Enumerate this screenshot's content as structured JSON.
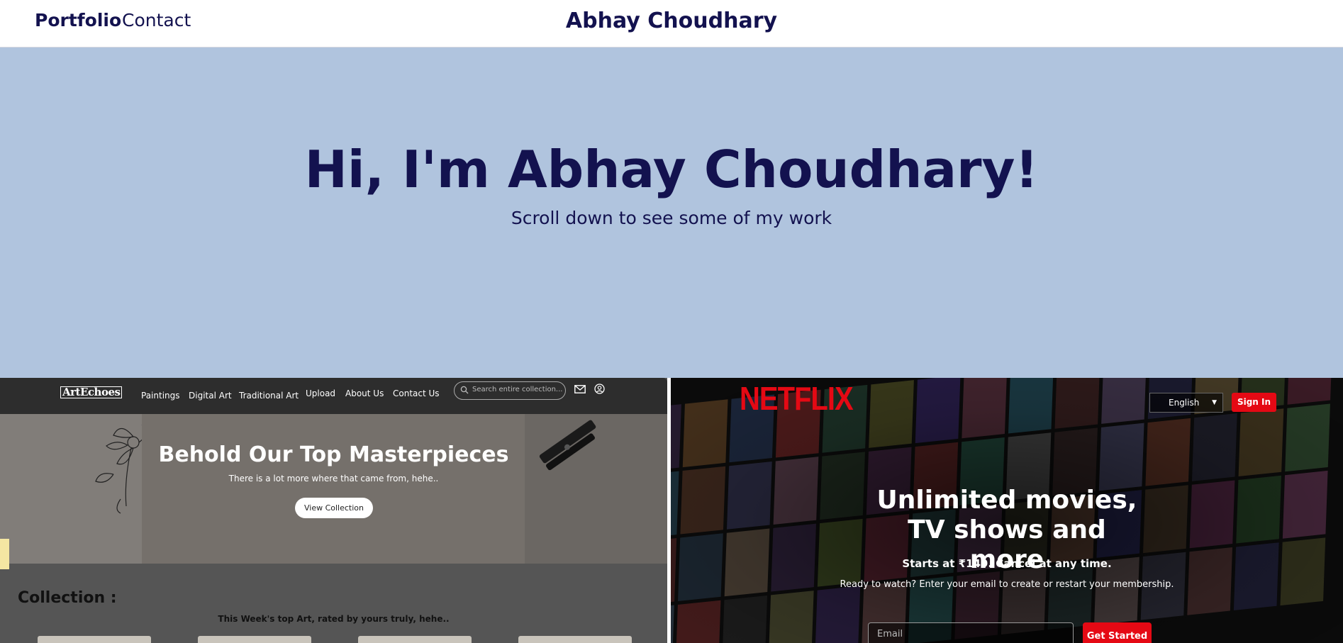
{
  "header": {
    "nav": [
      {
        "label": "Portfolio"
      },
      {
        "label": "Contact"
      }
    ],
    "site_title": "Abhay Choudhary"
  },
  "hero": {
    "title": "Hi, I'm Abhay Choudhary!",
    "subtitle": "Scroll down to see some of my work"
  },
  "projects": {
    "artechoes": {
      "logo": "ArtEchoes",
      "nav": [
        "Paintings",
        "Digital Art",
        "Traditional Art",
        "Upload",
        "About Us",
        "Contact Us"
      ],
      "search_placeholder": "Search entire collection...",
      "hero_title": "Behold Our Top Masterpieces",
      "hero_tagline": "There is a lot more where that came from, hehe..",
      "cta": "View Collection",
      "collection_heading": "Collection :",
      "weekly_text": "This Week's top Art, rated by yours truly, hehe.."
    },
    "netflix": {
      "logo": "NETFLIX",
      "language": "English",
      "sign_in": "Sign In",
      "headline": "Unlimited movies, TV shows and more",
      "price": "Starts at ₹149. Cancel at any time.",
      "ready": "Ready to watch? Enter your email to create or restart your membership.",
      "email_placeholder": "Email",
      "get_started": "Get Started"
    }
  },
  "colors": {
    "navy": "#13124f",
    "hero_bg": "#b0c4de",
    "netflix_red": "#e50914"
  }
}
